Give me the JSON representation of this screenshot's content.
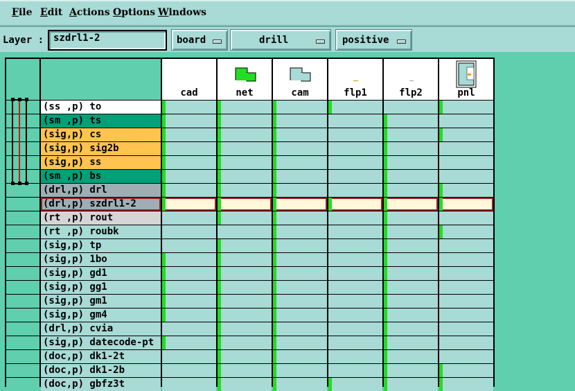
{
  "menu": [
    {
      "label": "File",
      "u": "F",
      "rest": "ile"
    },
    {
      "label": "Edit",
      "u": "E",
      "rest": "dit"
    },
    {
      "label": "Actions",
      "u": "A",
      "rest": "ctions"
    },
    {
      "label": "Options",
      "u": "O",
      "rest": "ptions"
    },
    {
      "label": "Windows",
      "u": "W",
      "rest": "indows"
    }
  ],
  "layer": {
    "label": "Layer :",
    "value": "szdrl1-2",
    "context": "board",
    "type": "drill",
    "polarity": "positive"
  },
  "steps": [
    "cad",
    "net",
    "cam",
    "flp1",
    "flp2",
    "pnl"
  ],
  "step_icons": [
    "",
    "net-icon",
    "cam-icon",
    "flp1-icon",
    "flp2-icon",
    "pnl-icon"
  ],
  "rows": [
    {
      "label": "(ss ,p) to",
      "color": "#ffffff"
    },
    {
      "label": "(sm ,p) ts",
      "color": "#00a078"
    },
    {
      "label": "(sig,p) cs",
      "color": "#ffc34f"
    },
    {
      "label": "(sig,p) sig2b",
      "color": "#ffc34f"
    },
    {
      "label": "(sig,p) ss",
      "color": "#ffc34f"
    },
    {
      "label": "(sm ,p) bs",
      "color": "#00a078"
    },
    {
      "label": "(drl,p) drl",
      "color": "#9eaeb4"
    },
    {
      "label": "(drl,p) szdrl1-2",
      "color": "#9eaeb4",
      "selected": true
    },
    {
      "label": "(rt ,p) rout",
      "color": "#d5d5d5"
    },
    {
      "label": "(rt ,p) roubk",
      "color": "#a8dad6"
    },
    {
      "label": "(sig,p) tp",
      "color": "#a8dad6"
    },
    {
      "label": "(sig,p) 1bo",
      "color": "#a8dad6"
    },
    {
      "label": "(sig,p) gd1",
      "color": "#a8dad6"
    },
    {
      "label": "(sig,p) gg1",
      "color": "#a8dad6"
    },
    {
      "label": "(sig,p) gm1",
      "color": "#a8dad6"
    },
    {
      "label": "(sig,p) gm4",
      "color": "#a8dad6"
    },
    {
      "label": "(drl,p) cvia",
      "color": "#a8dad6"
    },
    {
      "label": "(sig,p) datecode-pt",
      "color": "#a8dad6"
    },
    {
      "label": "(doc,p) dk1-2t",
      "color": "#a8dad6"
    },
    {
      "label": "(doc,p) dk1-2b",
      "color": "#a8dad6"
    },
    {
      "label": "(doc,p) gbfz3t",
      "color": "#a8dad6"
    }
  ],
  "affected": [
    [
      1,
      1,
      1,
      1,
      0,
      1
    ],
    [
      1,
      1,
      1,
      0,
      1,
      0
    ],
    [
      1,
      1,
      1,
      0,
      1,
      1
    ],
    [
      1,
      1,
      1,
      0,
      1,
      0
    ],
    [
      1,
      1,
      1,
      0,
      1,
      0
    ],
    [
      1,
      1,
      1,
      0,
      1,
      0
    ],
    [
      1,
      1,
      1,
      0,
      1,
      1
    ],
    [
      1,
      1,
      1,
      1,
      1,
      1
    ],
    [
      0,
      1,
      1,
      0,
      1,
      0
    ],
    [
      0,
      0,
      1,
      0,
      1,
      1
    ],
    [
      0,
      1,
      1,
      0,
      1,
      0
    ],
    [
      1,
      1,
      1,
      0,
      1,
      0
    ],
    [
      1,
      1,
      1,
      0,
      1,
      0
    ],
    [
      1,
      1,
      1,
      0,
      1,
      0
    ],
    [
      1,
      1,
      1,
      0,
      1,
      0
    ],
    [
      1,
      1,
      1,
      0,
      1,
      0
    ],
    [
      0,
      1,
      1,
      0,
      1,
      0
    ],
    [
      1,
      1,
      1,
      0,
      1,
      0
    ],
    [
      0,
      1,
      1,
      0,
      1,
      0
    ],
    [
      0,
      1,
      1,
      0,
      1,
      1
    ],
    [
      0,
      1,
      1,
      1,
      1,
      1
    ]
  ],
  "colors": {
    "background": "#5fcfae",
    "panel": "#a8dad6",
    "affected": "#22dd22",
    "selected_fill": "#fff8d8",
    "selected_border": "#9a2020",
    "bracket": "#d01818"
  }
}
